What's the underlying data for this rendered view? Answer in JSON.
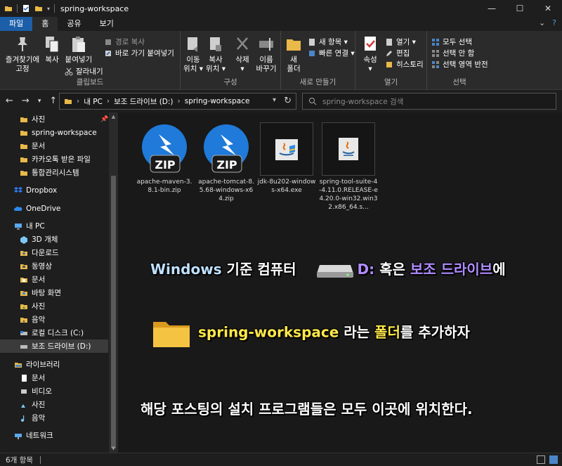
{
  "window": {
    "title": "spring-workspace",
    "minimize": "—",
    "maximize": "☐",
    "close": "✕"
  },
  "ribbon_tabs": [
    "파일",
    "홈",
    "공유",
    "보기"
  ],
  "ribbon": {
    "clipboard": {
      "pin_quick": "즐겨찾기에\n고정",
      "copy": "복사",
      "paste": "붙여넣기",
      "copy_path": "경로 복사",
      "paste_shortcut": "바로 가기 붙여넣기",
      "cut": "잘라내기",
      "label": "클립보드"
    },
    "organize": {
      "move_to": "이동\n위치 ▾",
      "copy_to": "복사\n위치 ▾",
      "delete": "삭제\n▾",
      "rename": "이름\n바꾸기",
      "label": "구성"
    },
    "new": {
      "new_folder": "새\n폴더",
      "new_item": "새 항목 ▾",
      "easy_access": "빠른 연결 ▾",
      "label": "새로 만들기"
    },
    "open": {
      "properties": "속성\n▾",
      "open": "열기 ▾",
      "edit": "편집",
      "history": "히스토리",
      "label": "열기"
    },
    "select": {
      "select_all": "모두 선택",
      "select_none": "선택 안 함",
      "invert": "선택 영역 반전",
      "label": "선택"
    }
  },
  "address": {
    "crumbs": [
      "내 PC",
      "보조 드라이브 (D:)",
      "spring-workspace"
    ],
    "search_placeholder": "spring-workspace 검색"
  },
  "sidebar": {
    "items": [
      {
        "label": "사진",
        "icon": "folder-icon",
        "pinned": true
      },
      {
        "label": "spring-workspace",
        "icon": "folder-icon"
      },
      {
        "label": "문서",
        "icon": "folder-icon"
      },
      {
        "label": "카카오톡 받은 파일",
        "icon": "folder-icon"
      },
      {
        "label": "통합관리시스템",
        "icon": "folder-icon"
      },
      {
        "label": "Dropbox",
        "icon": "dropbox-icon"
      },
      {
        "label": "OneDrive",
        "icon": "cloud-icon"
      },
      {
        "label": "내 PC",
        "icon": "pc-icon"
      },
      {
        "label": "3D 개체",
        "icon": "3d-icon"
      },
      {
        "label": "다운로드",
        "icon": "download-icon"
      },
      {
        "label": "동영상",
        "icon": "video-icon"
      },
      {
        "label": "문서",
        "icon": "document-icon"
      },
      {
        "label": "바탕 화면",
        "icon": "desktop-icon"
      },
      {
        "label": "사진",
        "icon": "picture-icon"
      },
      {
        "label": "음악",
        "icon": "music-icon"
      },
      {
        "label": "로컬 디스크 (C:)",
        "icon": "drive-icon"
      },
      {
        "label": "보조 드라이브 (D:)",
        "icon": "drive-icon",
        "selected": true
      },
      {
        "label": "라이브러리",
        "icon": "library-icon"
      },
      {
        "label": "문서",
        "icon": "document-icon"
      },
      {
        "label": "비디오",
        "icon": "video-icon"
      },
      {
        "label": "사진",
        "icon": "picture-icon"
      },
      {
        "label": "음악",
        "icon": "music-icon"
      },
      {
        "label": "네트워크",
        "icon": "network-icon"
      }
    ]
  },
  "files": [
    {
      "name": "apache-maven-3.8.1-bin.zip",
      "icon": "zip-icon",
      "badge": "ZIP"
    },
    {
      "name": "apache-tomcat-8.5.68-windows-x64.zip",
      "icon": "zip-icon",
      "badge": "ZIP"
    },
    {
      "name": "jdk-8u202-windows-x64.exe",
      "icon": "java-installer-icon"
    },
    {
      "name": "spring-tool-suite-4-4.11.0.RELEASE-e4.20.0-win32.win32.x86_64.s...",
      "icon": "java-icon"
    }
  ],
  "captions": {
    "line1": {
      "part1": "Windows",
      "part2": " 기준 컴퓨터",
      "part3": "D:",
      "part4": " 혹은 ",
      "part5": "보조 드라이브",
      "part6": "에"
    },
    "line2": {
      "part1": "spring-workspace",
      "part2": " 라는 ",
      "part3": "폴더",
      "part4": "를 추가하자"
    },
    "line3": "해당 포스팅의 설치 프로그램들은 모두 이곳에 위치한다."
  },
  "status": {
    "count": "6개 항목"
  },
  "colors": {
    "file_tab": "#1c5fa8",
    "folder": "#e9b949",
    "zip_blue": "#1f7ad9",
    "caption_blue": "#bfe0ff",
    "caption_purple": "#b08cff",
    "caption_yellow": "#ffe94a"
  }
}
